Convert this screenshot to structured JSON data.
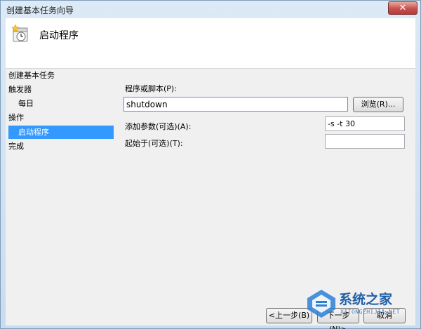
{
  "window": {
    "title": "创建基本任务向导",
    "close_label": "✕"
  },
  "header": {
    "title": "启动程序",
    "icon": "task-clock-icon"
  },
  "steps": [
    {
      "label": "创建基本任务",
      "indent": false,
      "selected": false
    },
    {
      "label": "触发器",
      "indent": false,
      "selected": false
    },
    {
      "label": "每日",
      "indent": true,
      "selected": false
    },
    {
      "label": "操作",
      "indent": false,
      "selected": false
    },
    {
      "label": "启动程序",
      "indent": true,
      "selected": true
    },
    {
      "label": "完成",
      "indent": false,
      "selected": false
    }
  ],
  "form": {
    "program_label": "程序或脚本(P):",
    "program_value": "shutdown",
    "browse_label": "浏览(R)...",
    "args_label": "添加参数(可选)(A):",
    "args_value": "-s -t 30",
    "startin_label": "起始于(可选)(T):",
    "startin_value": ""
  },
  "footer": {
    "back_label": "<上一步(B)",
    "next_label": "下一步(N)>",
    "cancel_label": "取消"
  },
  "watermark": {
    "text": "系统之家",
    "sub": "XITONGZHIJIA.NET"
  }
}
